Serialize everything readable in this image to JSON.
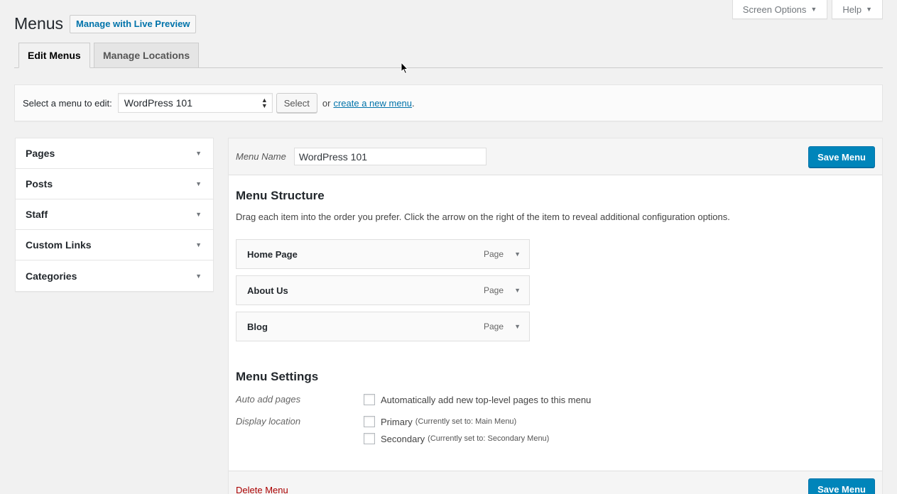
{
  "screen_meta": {
    "screen_options": "Screen Options",
    "help": "Help"
  },
  "header": {
    "title": "Menus",
    "live_preview": "Manage with Live Preview"
  },
  "tabs": [
    {
      "label": "Edit Menus"
    },
    {
      "label": "Manage Locations"
    }
  ],
  "select_bar": {
    "label": "Select a menu to edit:",
    "selected": "WordPress 101",
    "select_button": "Select",
    "or_text": "or",
    "create_link": "create a new menu",
    "period": "."
  },
  "sidebar": {
    "items": [
      {
        "label": "Pages"
      },
      {
        "label": "Posts"
      },
      {
        "label": "Staff"
      },
      {
        "label": "Custom Links"
      },
      {
        "label": "Categories"
      }
    ]
  },
  "menu_editor": {
    "name_label": "Menu Name",
    "name_value": "WordPress 101",
    "save_label": "Save Menu",
    "structure_title": "Menu Structure",
    "instructions": "Drag each item into the order you prefer. Click the arrow on the right of the item to reveal additional configuration options.",
    "items": [
      {
        "title": "Home Page",
        "type": "Page"
      },
      {
        "title": "About Us",
        "type": "Page"
      },
      {
        "title": "Blog",
        "type": "Page"
      }
    ],
    "settings_title": "Menu Settings",
    "auto_add_label": "Auto add pages",
    "auto_add_option": "Automatically add new top-level pages to this menu",
    "display_location_label": "Display location",
    "locations": [
      {
        "name": "Primary",
        "note": "(Currently set to: Main Menu)"
      },
      {
        "name": "Secondary",
        "note": "(Currently set to: Secondary Menu)"
      }
    ],
    "delete_label": "Delete Menu"
  }
}
